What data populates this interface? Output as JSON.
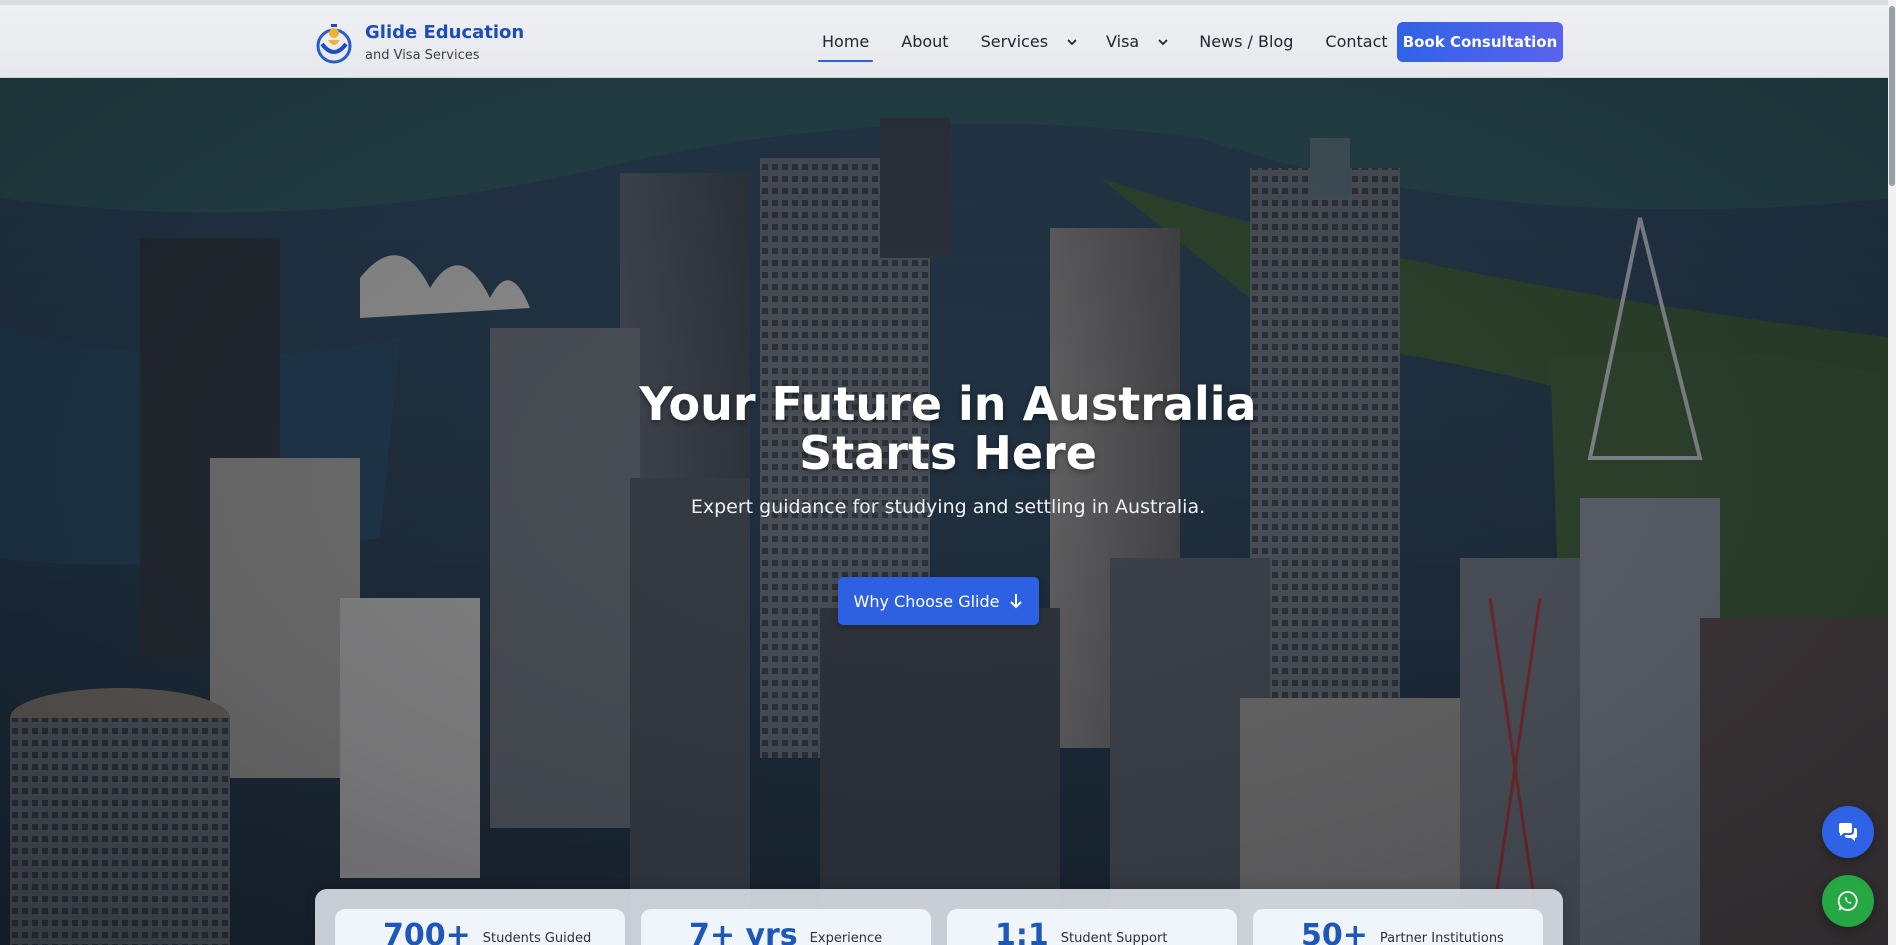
{
  "brand": {
    "title": "Glide Education",
    "subtitle": "and Visa Services"
  },
  "nav": {
    "items": [
      {
        "label": "Home",
        "active": true,
        "dropdown": false
      },
      {
        "label": "About",
        "active": false,
        "dropdown": false
      },
      {
        "label": "Services",
        "active": false,
        "dropdown": true
      },
      {
        "label": "Visa",
        "active": false,
        "dropdown": true
      },
      {
        "label": "News / Blog",
        "active": false,
        "dropdown": false
      },
      {
        "label": "Contact",
        "active": false,
        "dropdown": false
      }
    ],
    "cta_label": "Book Consultation"
  },
  "hero": {
    "title_line1": "Your Future in Australia",
    "title_line2": "Starts Here",
    "subtitle": "Expert guidance for studying and settling in Australia.",
    "cta_label": "Why Choose Glide"
  },
  "stats": [
    {
      "value": "700+",
      "label": "Students Guided"
    },
    {
      "value": "7+ yrs",
      "label": "Experience"
    },
    {
      "value": "1:1",
      "label": "Student Support"
    },
    {
      "value": "50+",
      "label": "Partner Institutions"
    }
  ],
  "colors": {
    "accent": "#2d61e2",
    "brand": "#1f4db6",
    "whatsapp": "#25a844"
  },
  "icons": {
    "chat": "chat-bubbles-icon",
    "whatsapp": "whatsapp-icon",
    "dropdown": "chevron-down-icon",
    "cta": "arrow-down-icon"
  }
}
